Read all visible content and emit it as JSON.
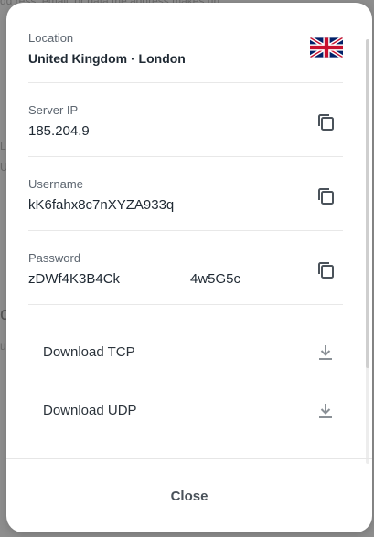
{
  "backdrop": {
    "fragments": [
      "dd ress, email, or data the address makes un",
      "Lo",
      "U",
      "o",
      "u"
    ]
  },
  "modal": {
    "location": {
      "label": "Location",
      "value": "United Kingdom · London",
      "flag": "uk-flag-icon"
    },
    "server_ip": {
      "label": "Server IP",
      "value": "185.204.9",
      "action_icon": "copy-icon"
    },
    "username": {
      "label": "Username",
      "value": "kK6fahx8c7nXYZA933q",
      "action_icon": "copy-icon"
    },
    "password": {
      "label": "Password",
      "value_start": "zDWf4K3B4Ck",
      "value_end": "4w5G5c",
      "action_icon": "copy-icon"
    },
    "downloads": [
      {
        "label": "Download TCP",
        "icon": "download-icon"
      },
      {
        "label": "Download UDP",
        "icon": "download-icon"
      }
    ],
    "close_label": "Close"
  },
  "colors": {
    "backdrop": "#8e8e8e",
    "surface": "#ffffff",
    "divider": "#e8e8e8",
    "icon": "#4a525a",
    "download_icon": "#8a9096"
  }
}
